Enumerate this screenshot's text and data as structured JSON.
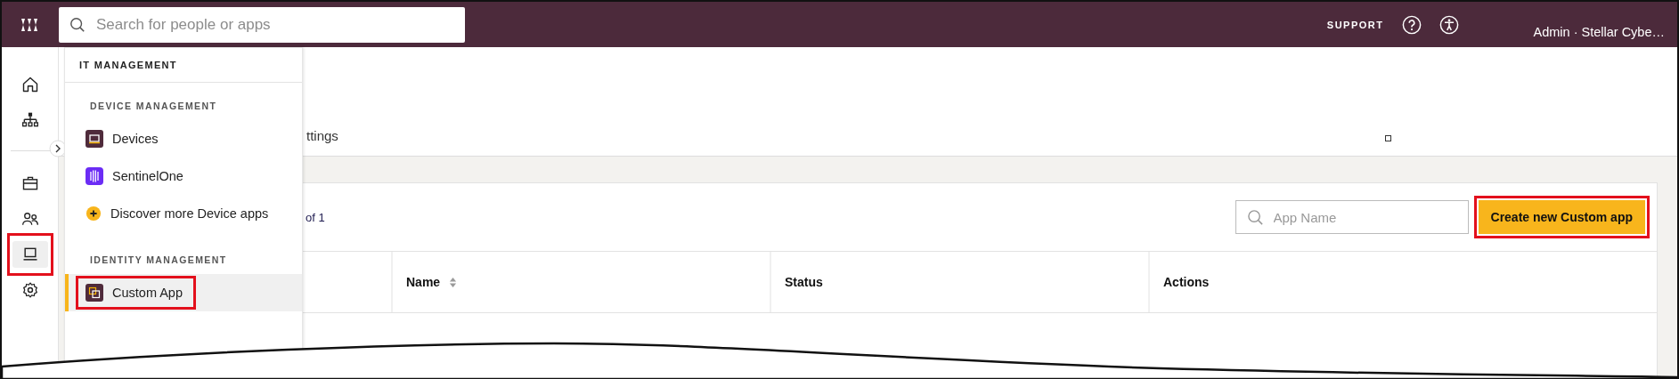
{
  "top_bar": {
    "search": {
      "placeholder": "Search for people or apps"
    },
    "support_label": "SUPPORT",
    "user_label": "Admin · Stellar Cybe…"
  },
  "sidebar": {
    "items": [
      {
        "kind": "home",
        "selected": false,
        "highlighted": false
      },
      {
        "kind": "org",
        "selected": false,
        "highlighted": false
      },
      {
        "kind": "briefcase",
        "selected": false,
        "highlighted": false
      },
      {
        "kind": "people",
        "selected": false,
        "highlighted": false
      },
      {
        "kind": "laptop",
        "selected": true,
        "highlighted": true
      },
      {
        "kind": "gear",
        "selected": false,
        "highlighted": false
      }
    ]
  },
  "menu": {
    "title": "IT MANAGEMENT",
    "sections": [
      {
        "heading": "DEVICE MANAGEMENT",
        "items": [
          {
            "label": "Devices",
            "kind": "device",
            "selected": false,
            "highlighted": false
          },
          {
            "label": "SentinelOne",
            "kind": "sentinel",
            "selected": false,
            "highlighted": false
          },
          {
            "label": "Discover more Device apps",
            "kind": "discover",
            "selected": false,
            "highlighted": false
          }
        ]
      },
      {
        "heading": "IDENTITY MANAGEMENT",
        "items": [
          {
            "label": "Custom App",
            "kind": "custom",
            "selected": true,
            "highlighted": true
          }
        ]
      }
    ]
  },
  "page": {
    "tab_label": "ttings",
    "pagination": "of 1",
    "search": {
      "placeholder": "App Name"
    },
    "create_button": {
      "label": "Create new Custom app",
      "highlighted": true
    },
    "table": {
      "columns": [
        {
          "label": "Name",
          "sortable": true
        },
        {
          "label": "Status",
          "sortable": false
        },
        {
          "label": "Actions",
          "sortable": false
        }
      ]
    }
  }
}
